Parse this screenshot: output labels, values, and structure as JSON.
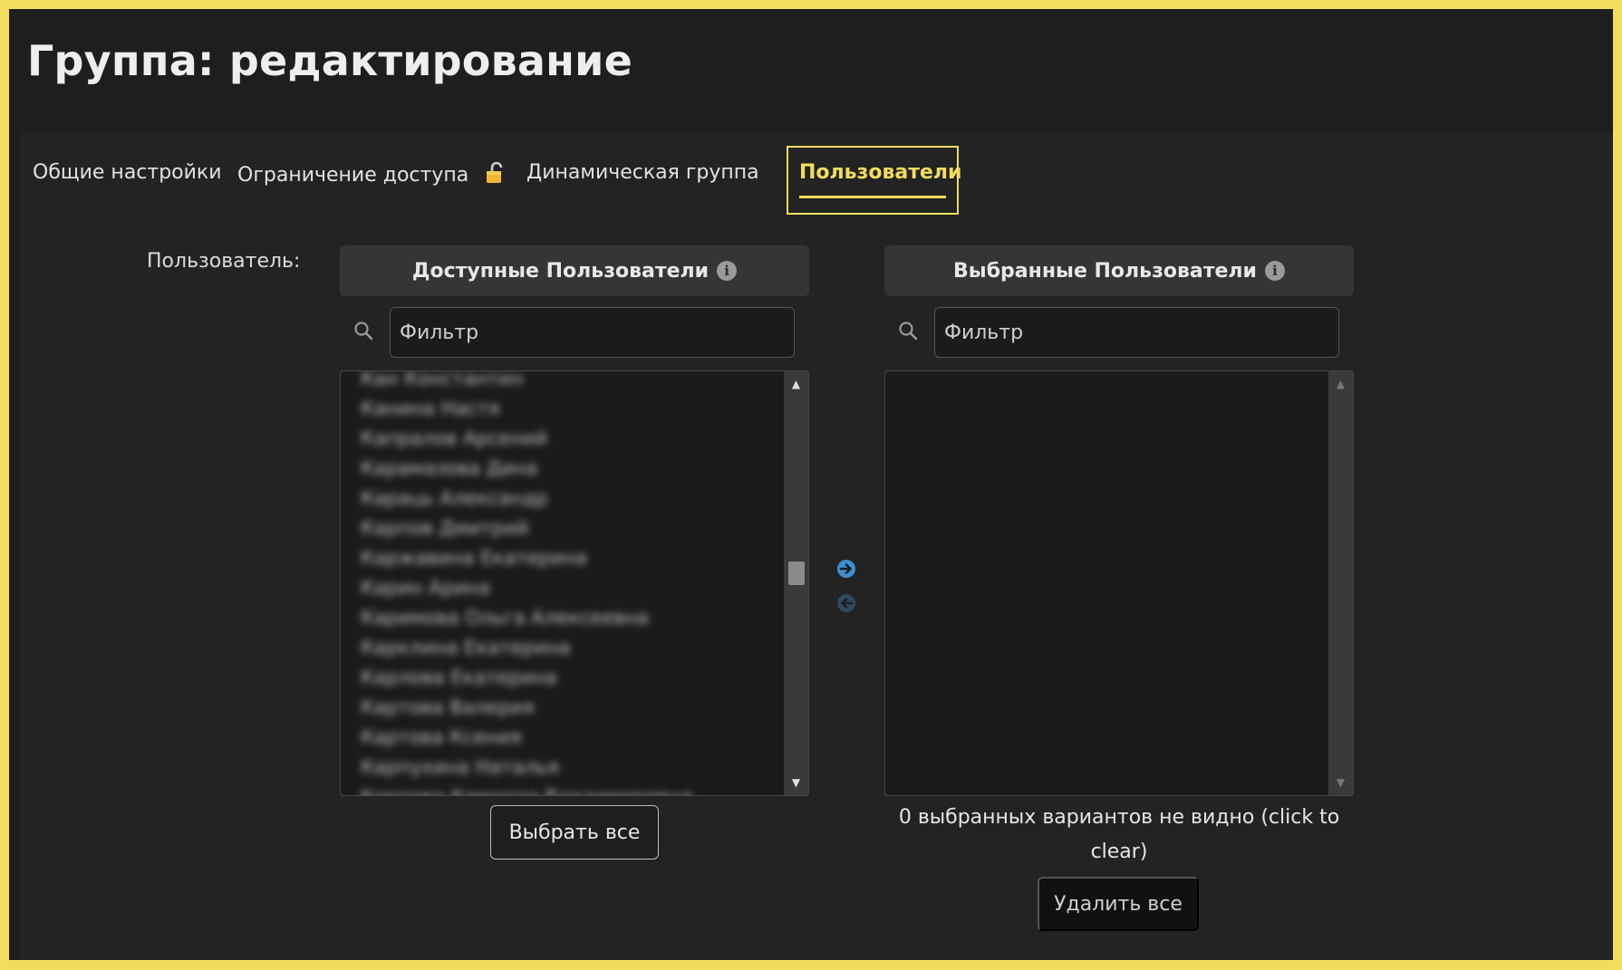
{
  "page": {
    "title": "Группа: редактирование"
  },
  "tabs": [
    {
      "label": "Общие настройки",
      "active": false
    },
    {
      "label": "Ограничение доступа",
      "active": false,
      "icon": "lock-icon"
    },
    {
      "label": "Динамическая группа",
      "active": false
    },
    {
      "label": "Пользователи",
      "active": true
    }
  ],
  "user_field": {
    "label": "Пользователь:"
  },
  "available": {
    "header": "Доступные Пользователи",
    "filter_placeholder": "Фильтр",
    "items": [
      "Кан Константин",
      "Канина Настя",
      "Капралов Арсений",
      "Карамазова Дина",
      "Караць Александр",
      "Карпов Дмитрий",
      "Каржавина Екатерина",
      "Карин Арина",
      "Каримова Ольга Алексеевна",
      "Карклина Екатерина",
      "Карлова Екатерина",
      "Картова Валерия",
      "Картова Ксения",
      "Карпухина Наталья",
      "Карпова Камилла Владимировна"
    ],
    "select_all_label": "Выбрать все"
  },
  "selected": {
    "header": "Выбранные Пользователи",
    "filter_placeholder": "Фильтр",
    "items": [],
    "hidden_note": "0 выбранных вариантов не видно (click to clear)",
    "remove_all_label": "Удалить все"
  },
  "colors": {
    "accent": "#f2dd5e",
    "background": "#1e1e1e",
    "panel": "#232323",
    "header_bg": "#353535",
    "arrow_active": "#3d8fcf"
  }
}
